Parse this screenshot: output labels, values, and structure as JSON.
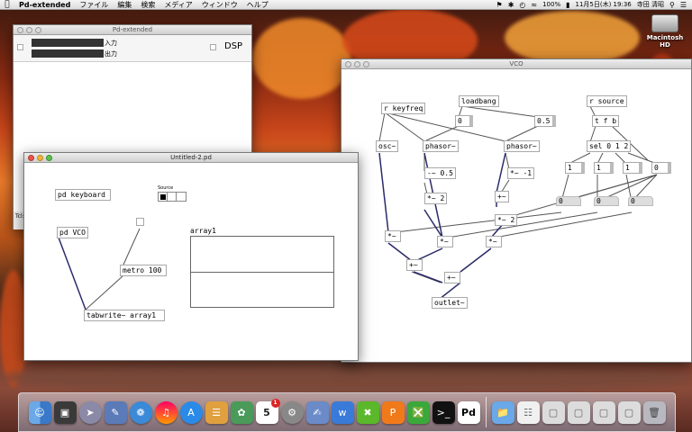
{
  "menubar": {
    "app_name": "Pd-extended",
    "items": [
      "ファイル",
      "編集",
      "検索",
      "メディア",
      "ウィンドウ",
      "ヘルプ"
    ],
    "battery": "100%",
    "clock": "11月5日(木) 19:36",
    "user": "寺田 清昭"
  },
  "desktop": {
    "hd_label": "Macintosh HD"
  },
  "main_window": {
    "title": "Pd-extended",
    "input_label": "入力",
    "output_label": "出力",
    "dsp_label": "DSP",
    "side_label": "Tcl:"
  },
  "patch_window": {
    "title": "Untitled-2.pd",
    "objects": {
      "keyboard": "pd keyboard",
      "source_label": "Source",
      "vco": "pd VCO",
      "metro": "metro 100",
      "tabwrite": "tabwrite~ array1",
      "array_name": "array1"
    }
  },
  "vco_window": {
    "title": "VCO",
    "objects": {
      "r_keyfreq": "r keyfreq",
      "loadbang": "loadbang",
      "r_source": "r source",
      "msg0": "0",
      "msg05": "0.5",
      "tfb": "t f b",
      "osc": "osc~",
      "phasor1": "phasor~",
      "phasor2": "phasor~",
      "sel": "sel 0 1 2",
      "minus05": "-~ 0.5",
      "minus1": "*~ -1",
      "mul2a": "*~ 2",
      "mul2b": "*~ 2",
      "msg1a": "1",
      "msg1b": "1",
      "msg1c": "1",
      "msg0b": "0",
      "n0a": "0",
      "n0b": "0",
      "n0c": "0",
      "mul_a": "*~",
      "mul_b": "*~",
      "mul_c": "*~",
      "mul_d": "*~",
      "plus_a": "+~",
      "plus_b": "+~",
      "plus_c": "+~",
      "outlet": "outlet~"
    }
  },
  "dock": {
    "running": "Pd",
    "calendar_day": "5",
    "mail_badge": "1",
    "icons": [
      "finder-icon",
      "dashboard-icon",
      "launchpad-icon",
      "preview-icon",
      "safari-icon",
      "itunes-icon",
      "appstore-icon",
      "ibooks-icon",
      "photos-icon",
      "calendar-icon",
      "system-preferences-icon",
      "notes-icon",
      "wiki-icon",
      "x-icon",
      "pages-icon",
      "evernote-icon",
      "terminal-icon",
      "pd-icon",
      "folder-icon",
      "document-icon",
      "window-icon",
      "window-icon-2",
      "window-icon-3",
      "window-icon-4",
      "trash-icon"
    ]
  },
  "colors": {
    "menubar": "#e6e6e6",
    "accent": "#3a3a8a",
    "dock": "#b9b9c6"
  }
}
